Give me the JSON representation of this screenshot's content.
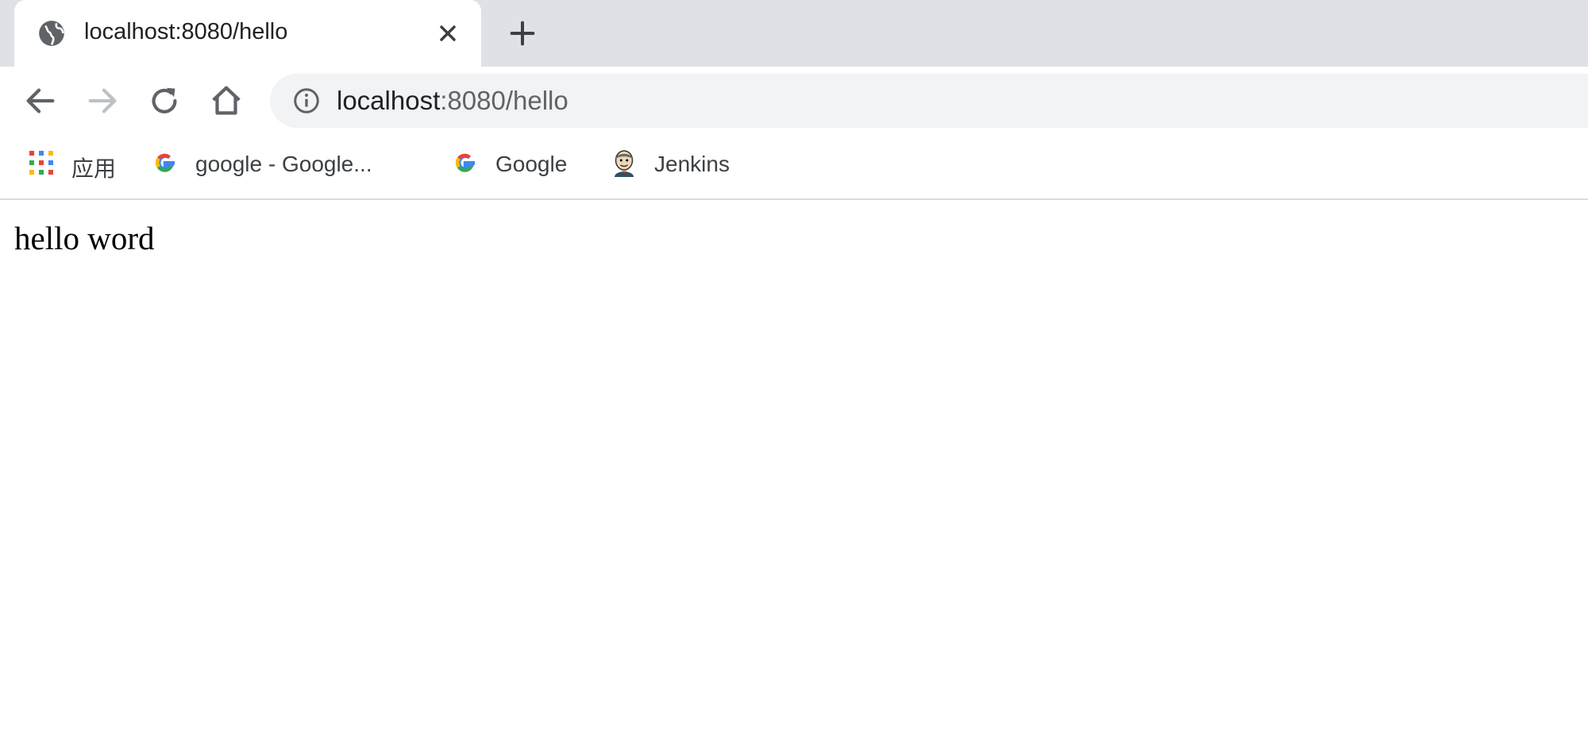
{
  "tab": {
    "title": "localhost:8080/hello",
    "favicon_icon": "globe-icon"
  },
  "toolbar": {
    "back_icon": "back-arrow-icon",
    "forward_icon": "forward-arrow-icon",
    "reload_icon": "reload-icon",
    "home_icon": "home-icon"
  },
  "omnibox": {
    "url_host": "localhost",
    "url_rest": ":8080/hello",
    "info_icon": "info-icon"
  },
  "bookmarks": [
    {
      "label": "应用",
      "icon": "apps-grid-icon"
    },
    {
      "label": "google - Google...",
      "icon": "google-icon"
    },
    {
      "label": "Google",
      "icon": "google-icon"
    },
    {
      "label": "Jenkins",
      "icon": "jenkins-icon"
    }
  ],
  "page": {
    "body_text": "hello word"
  }
}
